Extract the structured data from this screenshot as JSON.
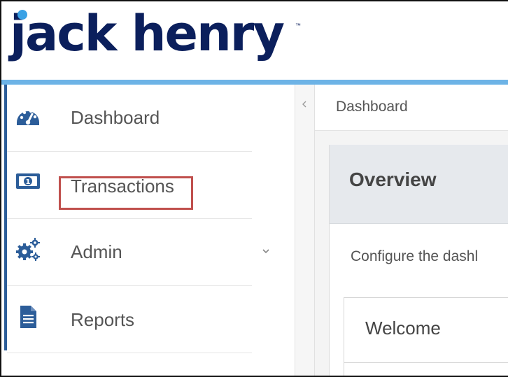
{
  "brand": {
    "logo_text": "jack henry",
    "trademark": "™",
    "primary_color": "#0b1f5c",
    "accent_color": "#6db3e6"
  },
  "sidebar": {
    "items": [
      {
        "label": "Dashboard",
        "icon": "dashboard-gauge-icon"
      },
      {
        "label": "Transactions",
        "icon": "money-bill-icon"
      },
      {
        "label": "Admin",
        "icon": "gears-icon",
        "expandable": true
      },
      {
        "label": "Reports",
        "icon": "document-icon"
      }
    ],
    "highlight_color": "#c0504d"
  },
  "breadcrumb": {
    "current": "Dashboard"
  },
  "main": {
    "overview": {
      "title": "Overview",
      "description": "Configure the dashl"
    },
    "welcome_card": {
      "title": "Welcome"
    }
  }
}
